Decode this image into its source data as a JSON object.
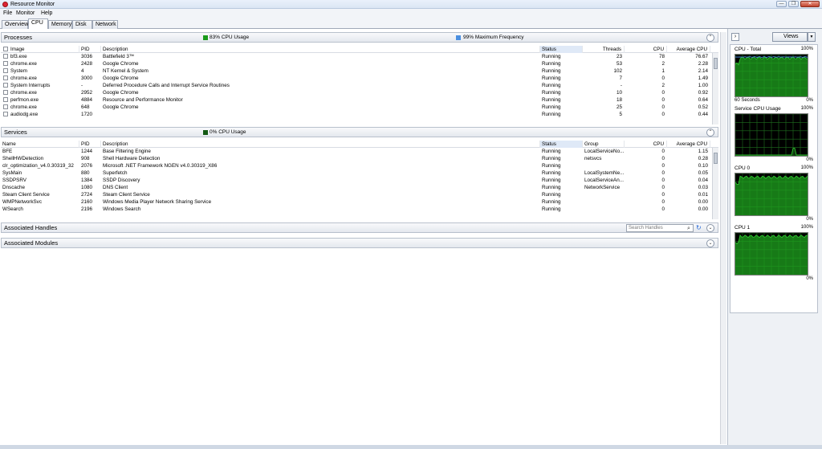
{
  "window": {
    "title": "Resource Monitor",
    "minimize": "—",
    "maximize": "❐",
    "close": "✕"
  },
  "menu": [
    "File",
    "Monitor",
    "Help"
  ],
  "tabs": [
    "Overview",
    "CPU",
    "Memory",
    "Disk",
    "Network"
  ],
  "colors": {
    "cpu_green": "#1a9a1a",
    "freq_blue": "#4a8fe0",
    "graph_green": "#2fc42f",
    "service_dark_green": "#145a14"
  },
  "processes": {
    "title": "Processes",
    "cpu_usage": "83% CPU Usage",
    "max_frequency": "99% Maximum Frequency",
    "columns": [
      "Image",
      "PID",
      "Description",
      "Status",
      "Threads",
      "CPU",
      "Average CPU"
    ],
    "rows": [
      [
        "bf3.exe",
        "3036",
        "Battlefield 3™",
        "Running",
        "23",
        "78",
        "76.67"
      ],
      [
        "chrome.exe",
        "2428",
        "Google Chrome",
        "Running",
        "53",
        "2",
        "2.28"
      ],
      [
        "System",
        "4",
        "NT Kernel & System",
        "Running",
        "102",
        "1",
        "2.14"
      ],
      [
        "chrome.exe",
        "3000",
        "Google Chrome",
        "Running",
        "7",
        "0",
        "1.49"
      ],
      [
        "System Interrupts",
        "-",
        "Deferred Procedure Calls and Interrupt Service Routines",
        "Running",
        "-",
        "2",
        "1.00"
      ],
      [
        "chrome.exe",
        "2952",
        "Google Chrome",
        "Running",
        "10",
        "0",
        "0.92"
      ],
      [
        "perfmon.exe",
        "4884",
        "Resource and Performance Monitor",
        "Running",
        "18",
        "0",
        "0.64"
      ],
      [
        "chrome.exe",
        "648",
        "Google Chrome",
        "Running",
        "25",
        "0",
        "0.52"
      ],
      [
        "audiodg.exe",
        "1720",
        "",
        "Running",
        "5",
        "0",
        "0.44"
      ]
    ]
  },
  "services": {
    "title": "Services",
    "cpu_usage": "0% CPU Usage",
    "columns": [
      "Name",
      "PID",
      "Description",
      "Status",
      "Group",
      "CPU",
      "Average CPU"
    ],
    "rows": [
      [
        "BFE",
        "1244",
        "Base Filtering Engine",
        "Running",
        "LocalServiceNo...",
        "0",
        "1.15"
      ],
      [
        "ShellHWDetection",
        "908",
        "Shell Hardware Detection",
        "Running",
        "netsvcs",
        "0",
        "0.28"
      ],
      [
        "clr_optimization_v4.0.30319_32",
        "2076",
        "Microsoft .NET Framework NGEN v4.0.30319_X86",
        "Running",
        "",
        "0",
        "0.10"
      ],
      [
        "SysMain",
        "880",
        "Superfetch",
        "Running",
        "LocalSystemNe...",
        "0",
        "0.05"
      ],
      [
        "SSDPSRV",
        "1384",
        "SSDP Discovery",
        "Running",
        "LocalServiceAn...",
        "0",
        "0.04"
      ],
      [
        "Dnscache",
        "1080",
        "DNS Client",
        "Running",
        "NetworkService",
        "0",
        "0.03"
      ],
      [
        "Steam Client Service",
        "2724",
        "Steam Client Service",
        "Running",
        "",
        "0",
        "0.01"
      ],
      [
        "WMPNetworkSvc",
        "2160",
        "Windows Media Player Network Sharing Service",
        "Running",
        "",
        "0",
        "0.00"
      ],
      [
        "WSearch",
        "2196",
        "Windows Search",
        "Running",
        "",
        "0",
        "0.00"
      ]
    ]
  },
  "handles": {
    "title": "Associated Handles",
    "search_placeholder": "Search Handles"
  },
  "modules": {
    "title": "Associated Modules"
  },
  "right_panel": {
    "views_label": "Views",
    "graphs": [
      {
        "title": "CPU - Total",
        "max": "100%",
        "footer_left": "60 Seconds",
        "footer_right": "0%",
        "level": 0.92,
        "dark": false
      },
      {
        "title": "Service CPU Usage",
        "max": "100%",
        "footer_left": "",
        "footer_right": "0%",
        "level": 0.02,
        "dark": true
      },
      {
        "title": "CPU 0",
        "max": "100%",
        "footer_left": "",
        "footer_right": "0%",
        "level": 0.91,
        "dark": false
      },
      {
        "title": "CPU 1",
        "max": "100%",
        "footer_left": "",
        "footer_right": "0%",
        "level": 0.92,
        "dark": false
      }
    ]
  }
}
